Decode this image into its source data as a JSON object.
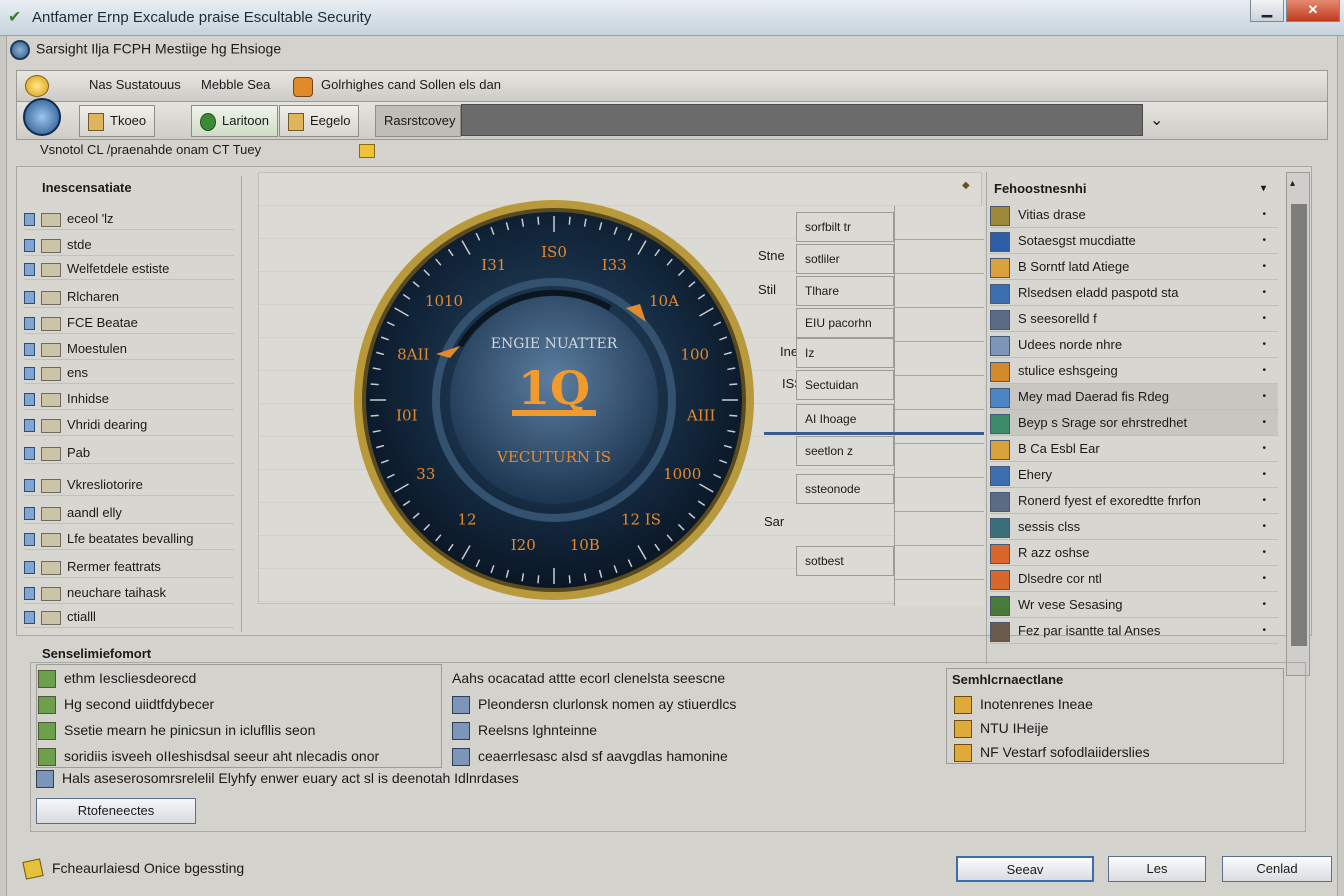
{
  "window": {
    "title": "Antfamer Ernp Excalude praise Escultable Security",
    "subtitle": "Sarsight Ilja FCPH Mestiige hg Ehsioge",
    "minimize_label": "▁",
    "close_label": "✕"
  },
  "toolbar": {
    "item1": "Nas Sustatouus",
    "item2": "Mebble Sea",
    "item3": "Golrhighes cand Sollen els dan"
  },
  "tabs": [
    "Tkoeo",
    "Laritoon",
    "Eegelo",
    "Rasrstcovey"
  ],
  "view_row": "Vsnotol CL /praenahde  onam CT Tuey",
  "tree": {
    "title": "Inescensatiate",
    "items": [
      "eceol 'lz",
      "stde",
      "Welfetdele estiste",
      "Rlcharen",
      "FCE Beatae",
      "Moestulen",
      "ens",
      "Inhidse",
      "Vhridi dearing",
      "Pab",
      "Vkresliotorire",
      "aandl elly",
      "Lfe beatates bevalling",
      "Rermer feattrats",
      "neuchare taihask",
      "ctialll"
    ]
  },
  "gauge": {
    "title": "ENGIE NUATTER",
    "value": "1Q",
    "subtitle": "VECUTURN IS",
    "ticks": [
      "IS0",
      "I33",
      "10A",
      "100",
      "AIII",
      "1000",
      "12 IS",
      "10B",
      "I20",
      "12",
      "33",
      "I0I",
      "8AII",
      "1010",
      "I31"
    ]
  },
  "mid_labels": [
    "Stne",
    "Stil",
    "Ine",
    "ISS",
    "Sar"
  ],
  "data_boxes": [
    "sorfbilt tr",
    "sotliler",
    "Tlhare",
    "EIU pacorhn",
    "Iz",
    "Sectuidan",
    "AI Ihoage",
    "seetlon z",
    "ssteonode",
    "sotbest"
  ],
  "right_panel": {
    "title": "Fehoostnesnhi",
    "items": [
      "Vitias drase",
      "Sotaesgst mucdiatte",
      "B Sorntf latd Atiege",
      "Rlsedsen eladd paspotd sta",
      "S seesorelld f",
      "Udees norde nhre",
      "stulice eshsgeing",
      "Mey mad Daerad fis Rdeg",
      "Beyp s Srage sor ehrstredhet",
      "B Ca Esbl Ear",
      "Ehery",
      "Ronerd fyest ef exoredtte fnrfon",
      "sessis clss",
      "R azz oshse",
      "Dlsedre cor ntl",
      "Wr vese Sesasing",
      "Fez par isantte tal Anses"
    ]
  },
  "bottom": {
    "title": "Senselimiefomort",
    "col1": [
      "ethm Iescliesdeorecd",
      "Hg second uiidtfdybecer",
      "Ssetie mearn he pinicsun in iclufllis seon",
      "soridiis isveeh oIIeshisdsal seeur aht nlecadis onor"
    ],
    "col2": [
      "Aahs ocacatad attte ecorl clenelsta seescne",
      "Pleondersn clurlonsk nomen ay stiuerdlcs",
      "Reelsns lghnteinne",
      "ceaerrlesasc aIsd sf aavgdlas hamonine"
    ],
    "col3_title": "Semhlcrnaectlane",
    "col3": [
      "Inotenrenes Ineae",
      "NTU IHeije",
      "NF Vestarf sofodlaiiderslies"
    ],
    "long_line": "Hals aseserosomrsrelelil Elyhfy enwer euary act sl is deenotah Idlnrdases",
    "ref_button": "Rtofeneectes"
  },
  "status_text": "Fcheaurlaiesd Onice bgessting",
  "dialog_buttons": [
    "Seeav",
    "Les",
    "Cenlad"
  ]
}
